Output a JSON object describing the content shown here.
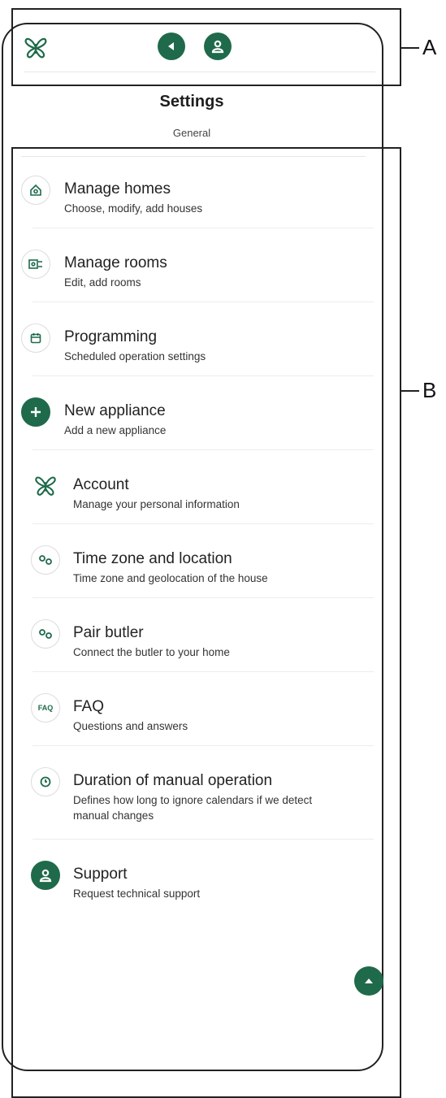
{
  "callouts": {
    "a": "A",
    "b": "B"
  },
  "header": {
    "logo_icon": "butterfly-logo-icon",
    "back_icon": "back-icon",
    "profile_icon": "user-icon"
  },
  "page": {
    "title": "Settings",
    "subtitle": "General"
  },
  "items": [
    {
      "icon": "house-icon",
      "title": "Manage homes",
      "desc": "Choose, modify, add houses"
    },
    {
      "icon": "room-icon",
      "title": "Manage rooms",
      "desc": "Edit, add rooms"
    },
    {
      "icon": "calendar-icon",
      "title": "Programming",
      "desc": "Scheduled operation settings"
    },
    {
      "icon": "plus-icon",
      "title": "New appliance",
      "desc": "Add a new appliance"
    },
    {
      "icon": "butterfly-icon",
      "title": "Account",
      "desc": "Manage your personal information"
    },
    {
      "icon": "location-icon",
      "title": "Time zone and location",
      "desc": "Time zone and geolocation of the house"
    },
    {
      "icon": "link-icon",
      "title": "Pair butler",
      "desc": "Connect the butler to your home"
    },
    {
      "icon": "faq-icon",
      "icon_text": "FAQ",
      "title": "FAQ",
      "desc": "Questions and answers"
    },
    {
      "icon": "clock-icon",
      "title": "Duration of manual operation",
      "desc": "Defines how long to ignore calendars if we detect manual changes"
    },
    {
      "icon": "support-icon",
      "title": "Support",
      "desc": "Request technical support"
    }
  ],
  "scroll_top_icon": "chevron-up-icon",
  "colors": {
    "accent": "#1f6a4a",
    "text": "#222222",
    "divider": "#ececec"
  }
}
